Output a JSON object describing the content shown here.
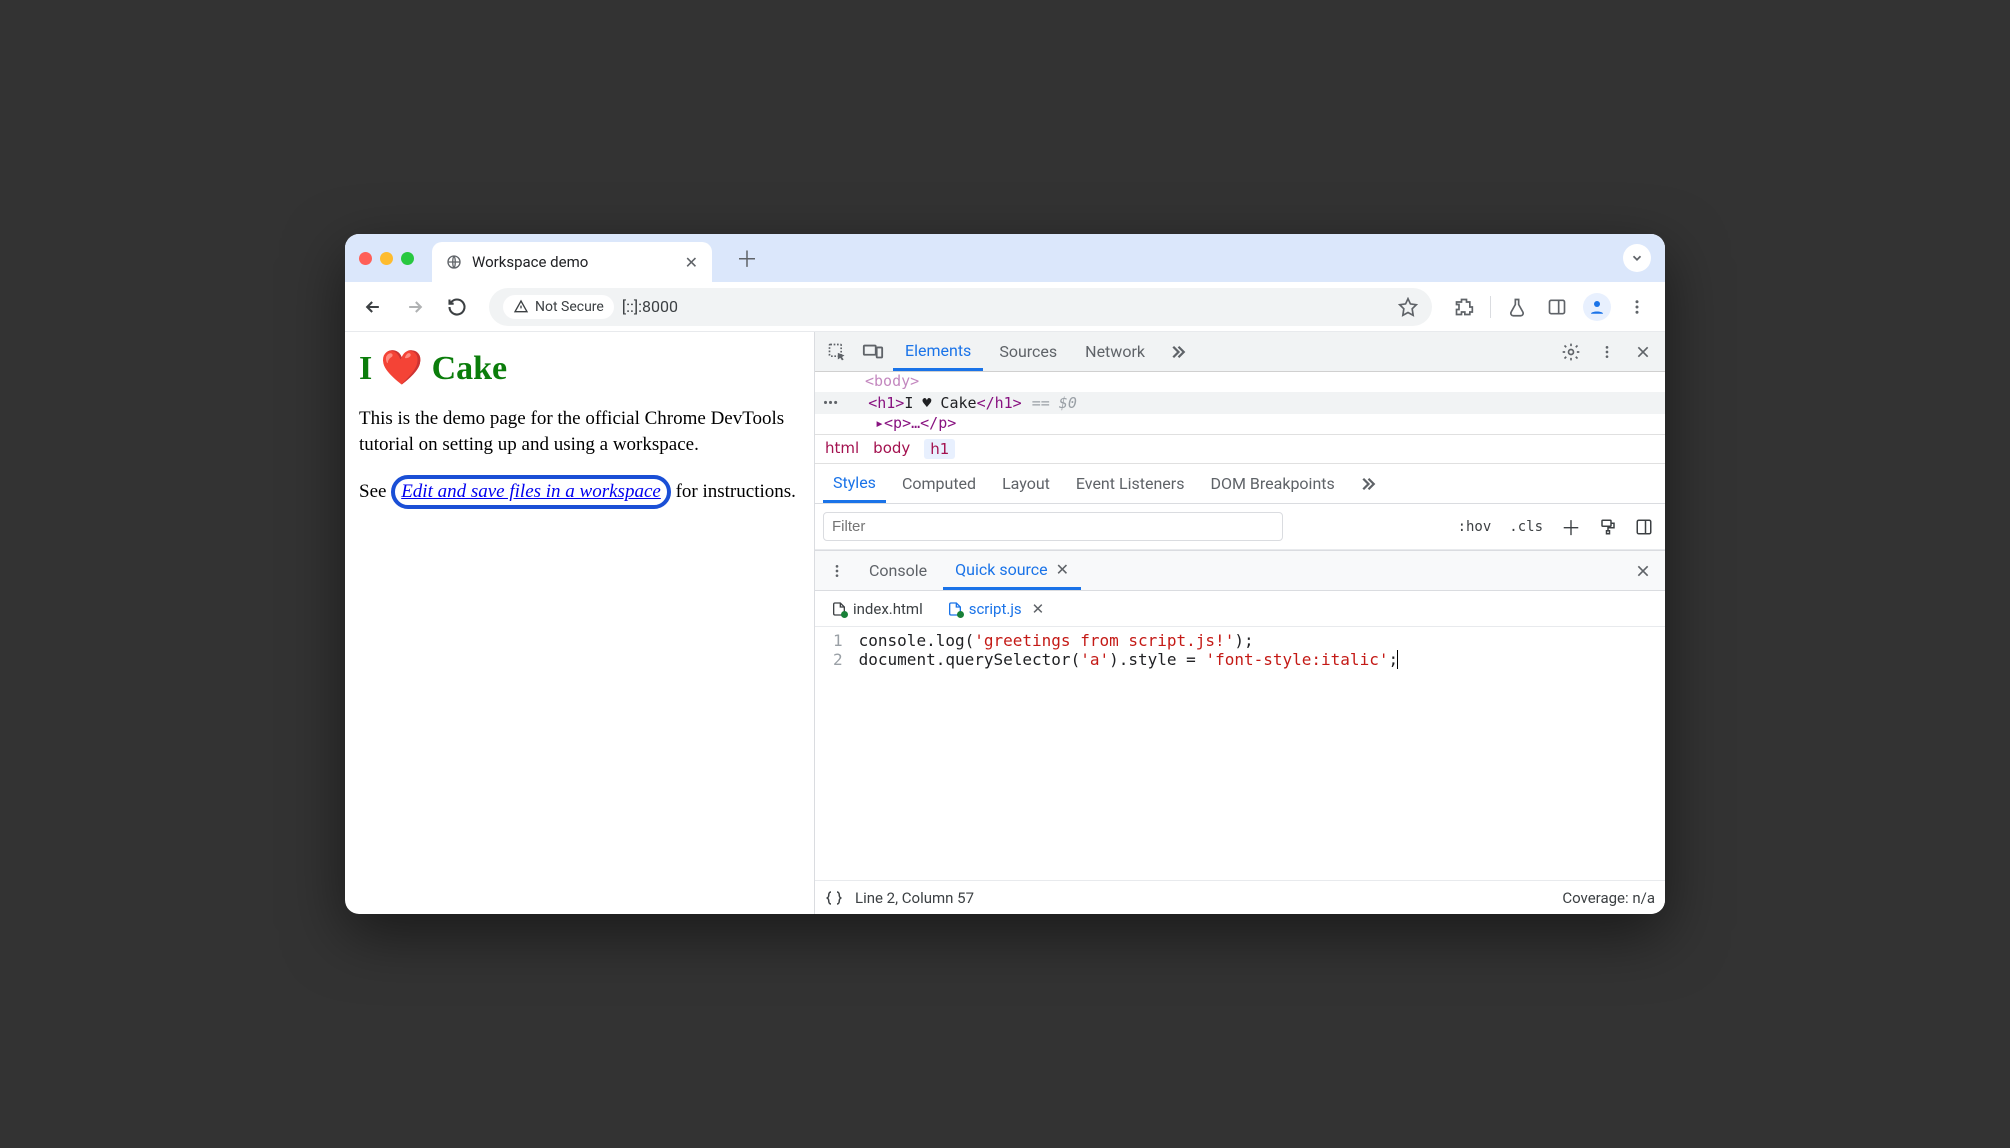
{
  "browser": {
    "tab_title": "Workspace demo",
    "omnibox": {
      "security_label": "Not Secure",
      "url": "[::]:8000"
    }
  },
  "page": {
    "heading": "I ❤️ Cake",
    "para1": "This is the demo page for the official Chrome DevTools tutorial on setting up and using a workspace.",
    "para2_prefix": "See ",
    "link_text": "Edit and save files in a workspace",
    "para2_suffix": " for instructions."
  },
  "devtools": {
    "tabs": {
      "elements": "Elements",
      "sources": "Sources",
      "network": "Network"
    },
    "dom": {
      "above": "<body>",
      "open_tag": "<h1>",
      "text": "I ♥ Cake",
      "close_tag": "</h1>",
      "eq": "== $0",
      "below": "<p>…</p>"
    },
    "crumbs": {
      "html": "html",
      "body": "body",
      "h1": "h1"
    },
    "styles_tabs": {
      "styles": "Styles",
      "computed": "Computed",
      "layout": "Layout",
      "event_listeners": "Event Listeners",
      "dom_breakpoints": "DOM Breakpoints"
    },
    "filter_placeholder": "Filter",
    "filter_tools": {
      "hov": ":hov",
      "cls": ".cls"
    },
    "drawer": {
      "console": "Console",
      "quick_source": "Quick source",
      "files": {
        "index": "index.html",
        "script": "script.js"
      },
      "code": {
        "line1": {
          "pre": "console.log(",
          "str": "'greetings from script.js!'",
          "post": ");"
        },
        "line2": {
          "pre": "document.querySelector(",
          "arg": "'a'",
          "mid": ").style = ",
          "val": "'font-style:italic'",
          "post": ";"
        }
      },
      "status": {
        "pos": "Line 2, Column 57",
        "coverage": "Coverage: n/a"
      }
    }
  }
}
